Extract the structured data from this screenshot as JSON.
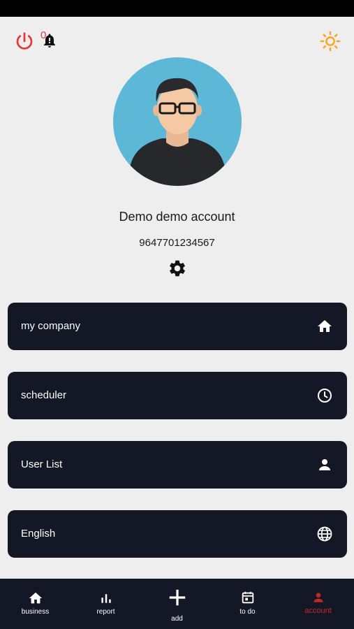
{
  "header": {
    "notification_badge": "0",
    "icons": {
      "power": "power-icon",
      "notifications": "bell-alert-icon",
      "theme": "sun-icon"
    }
  },
  "profile": {
    "name": "Demo demo account",
    "phone": "9647701234567",
    "settings_icon": "gear-icon"
  },
  "menu": [
    {
      "label": "my company",
      "icon": "home-icon"
    },
    {
      "label": "scheduler",
      "icon": "clock-icon"
    },
    {
      "label": "User List",
      "icon": "person-icon"
    },
    {
      "label": "English",
      "icon": "globe-icon"
    }
  ],
  "bottom_nav": [
    {
      "label": "business",
      "icon": "home-icon",
      "active": false
    },
    {
      "label": "report",
      "icon": "bar-chart-icon",
      "active": false
    },
    {
      "label": "add",
      "icon": "plus-icon",
      "active": false
    },
    {
      "label": "to do",
      "icon": "calendar-icon",
      "active": false
    },
    {
      "label": "account",
      "icon": "person-icon",
      "active": true
    }
  ],
  "colors": {
    "background": "#eeeeee",
    "card": "#141826",
    "accent_active": "#c62828",
    "power_red": "#e53935",
    "sun_orange": "#f5a623",
    "avatar_bg": "#5db8d8"
  }
}
